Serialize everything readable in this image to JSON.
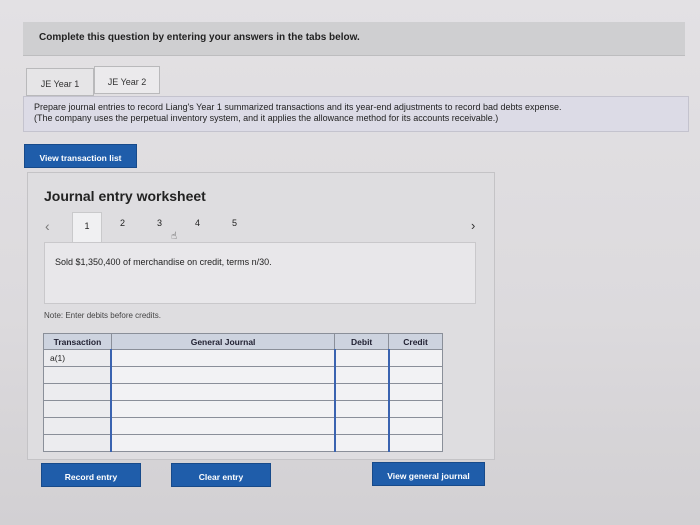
{
  "header": {
    "title": "Complete this question by entering your answers in the tabs below."
  },
  "tabs": [
    {
      "label": "JE Year 1"
    },
    {
      "label": "JE Year 2"
    }
  ],
  "instructions": {
    "line1": "Prepare journal entries to record Liang's Year 1 summarized transactions and its year-end adjustments to record bad debts expense.",
    "line2": "(The company uses the perpetual inventory system, and it applies the allowance method for its accounts receivable.)"
  },
  "buttons": {
    "view_transaction_list": "View transaction list",
    "record_entry": "Record entry",
    "clear_entry": "Clear entry",
    "view_general_journal": "View general journal"
  },
  "worksheet": {
    "title": "Journal entry worksheet",
    "pages": [
      "1",
      "2",
      "3",
      "4",
      "5"
    ],
    "description": "Sold $1,350,400 of merchandise on credit, terms n/30.",
    "note": "Note: Enter debits before credits."
  },
  "table": {
    "headers": {
      "transaction": "Transaction",
      "general_journal": "General Journal",
      "debit": "Debit",
      "credit": "Credit"
    },
    "rows": [
      {
        "transaction": "a(1)"
      },
      {
        "transaction": ""
      },
      {
        "transaction": ""
      },
      {
        "transaction": ""
      },
      {
        "transaction": ""
      },
      {
        "transaction": ""
      }
    ]
  }
}
